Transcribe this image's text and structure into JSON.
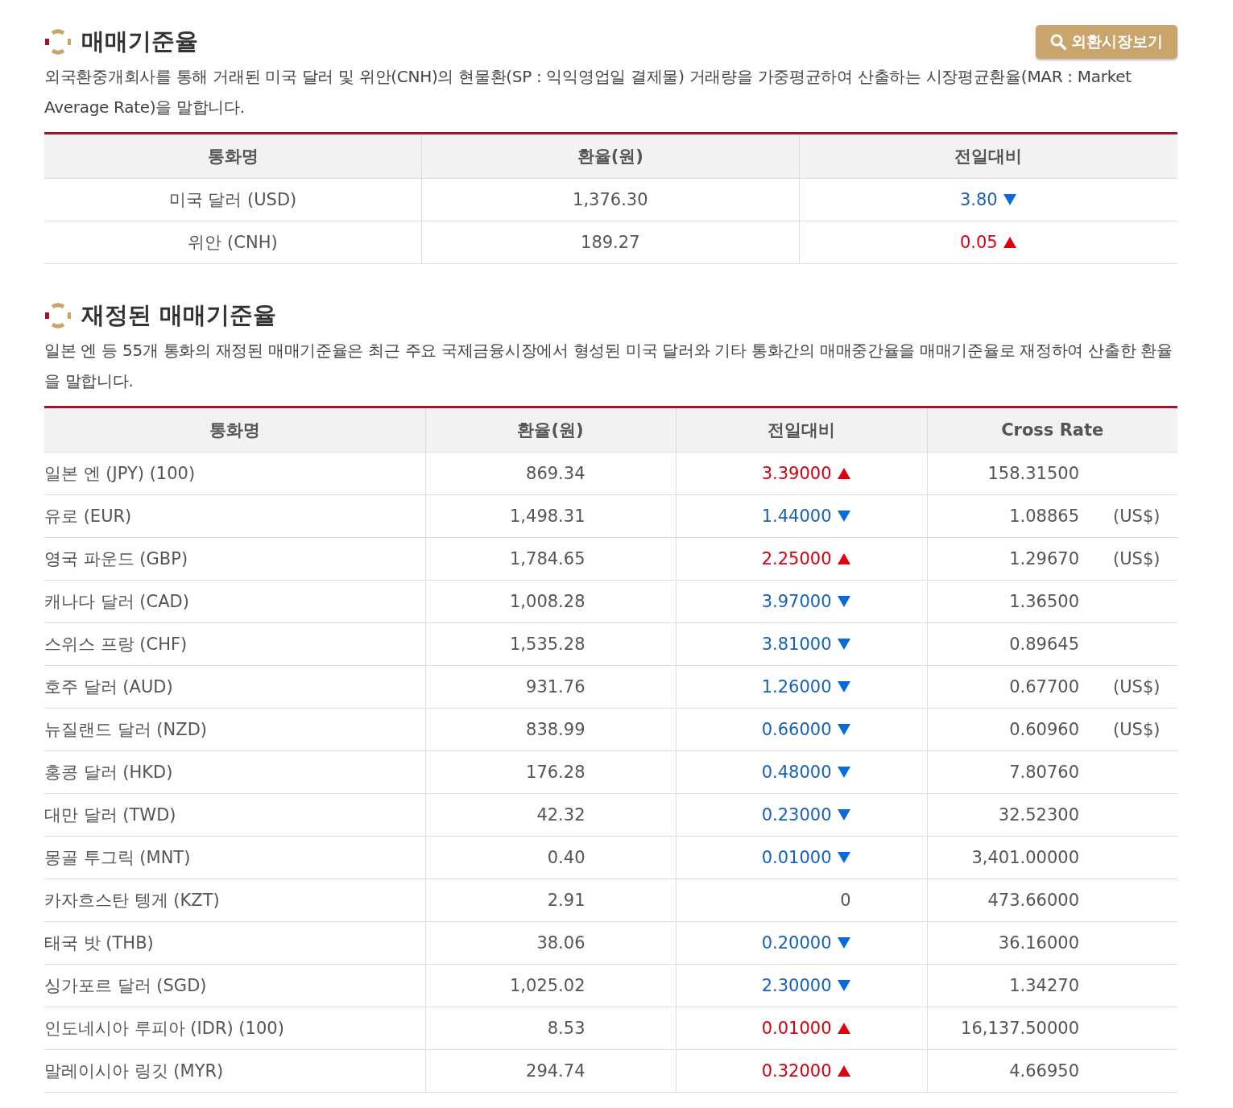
{
  "sections": [
    {
      "title": "매매기준율",
      "button": {
        "label": "외환시장보기"
      },
      "description": "외국환중개회사를 통해 거래된 미국 달러 및 위안(CNH)의 현물환(SP : 익익영업일 결제물) 거래량을 가중평균하여 산출하는 시장평균환율(MAR : Market Average Rate)을 말합니다.",
      "table": {
        "kind": "simple",
        "columns": [
          "통화명",
          "환율(원)",
          "전일대비"
        ],
        "rows": [
          {
            "name": "미국 달러 (USD)",
            "rate": "1,376.30",
            "change": "3.80",
            "kind": "down"
          },
          {
            "name": "위안 (CNH)",
            "rate": "189.27",
            "change": "0.05",
            "kind": "up"
          }
        ]
      }
    },
    {
      "title": "재정된 매매기준율",
      "description": "일본 엔 등 55개 통화의 재정된 매매기준율은 최근 주요 국제금융시장에서 형성된 미국 달러와 기타 통화간의 매매중간율을 매매기준율로 재정하여 산출한 환율을 말합니다.",
      "table": {
        "kind": "cross",
        "columns": [
          "통화명",
          "환율(원)",
          "전일대비",
          "Cross Rate"
        ],
        "rows": [
          {
            "name": "일본 엔 (JPY) (100)",
            "rate": "869.34",
            "change": "3.39000",
            "kind": "up",
            "cross_rate": "158.31500"
          },
          {
            "name": "유로 (EUR)",
            "rate": "1,498.31",
            "change": "1.44000",
            "kind": "down",
            "cross_rate": "1.08865",
            "cross_unit": "(US$)"
          },
          {
            "name": "영국 파운드 (GBP)",
            "rate": "1,784.65",
            "change": "2.25000",
            "kind": "up",
            "cross_rate": "1.29670",
            "cross_unit": "(US$)"
          },
          {
            "name": "캐나다 달러 (CAD)",
            "rate": "1,008.28",
            "change": "3.97000",
            "kind": "down",
            "cross_rate": "1.36500"
          },
          {
            "name": "스위스 프랑 (CHF)",
            "rate": "1,535.28",
            "change": "3.81000",
            "kind": "down",
            "cross_rate": "0.89645"
          },
          {
            "name": "호주 달러 (AUD)",
            "rate": "931.76",
            "change": "1.26000",
            "kind": "down",
            "cross_rate": "0.67700",
            "cross_unit": "(US$)"
          },
          {
            "name": "뉴질랜드 달러 (NZD)",
            "rate": "838.99",
            "change": "0.66000",
            "kind": "down",
            "cross_rate": "0.60960",
            "cross_unit": "(US$)"
          },
          {
            "name": "홍콩 달러 (HKD)",
            "rate": "176.28",
            "change": "0.48000",
            "kind": "down",
            "cross_rate": "7.80760"
          },
          {
            "name": "대만 달러 (TWD)",
            "rate": "42.32",
            "change": "0.23000",
            "kind": "down",
            "cross_rate": "32.52300"
          },
          {
            "name": "몽골 투그릭 (MNT)",
            "rate": "0.40",
            "change": "0.01000",
            "kind": "down",
            "cross_rate": "3,401.00000"
          },
          {
            "name": "카자흐스탄 텡게 (KZT)",
            "rate": "2.91",
            "change": "0",
            "kind": "none",
            "cross_rate": "473.66000"
          },
          {
            "name": "태국 밧 (THB)",
            "rate": "38.06",
            "change": "0.20000",
            "kind": "down",
            "cross_rate": "36.16000"
          },
          {
            "name": "싱가포르 달러 (SGD)",
            "rate": "1,025.02",
            "change": "2.30000",
            "kind": "down",
            "cross_rate": "1.34270"
          },
          {
            "name": "인도네시아 루피아 (IDR) (100)",
            "rate": "8.53",
            "change": "0.01000",
            "kind": "up",
            "cross_rate": "16,137.50000"
          },
          {
            "name": "말레이시아 링깃 (MYR)",
            "rate": "294.74",
            "change": "0.32000",
            "kind": "up",
            "cross_rate": "4.66950"
          }
        ]
      }
    }
  ]
}
